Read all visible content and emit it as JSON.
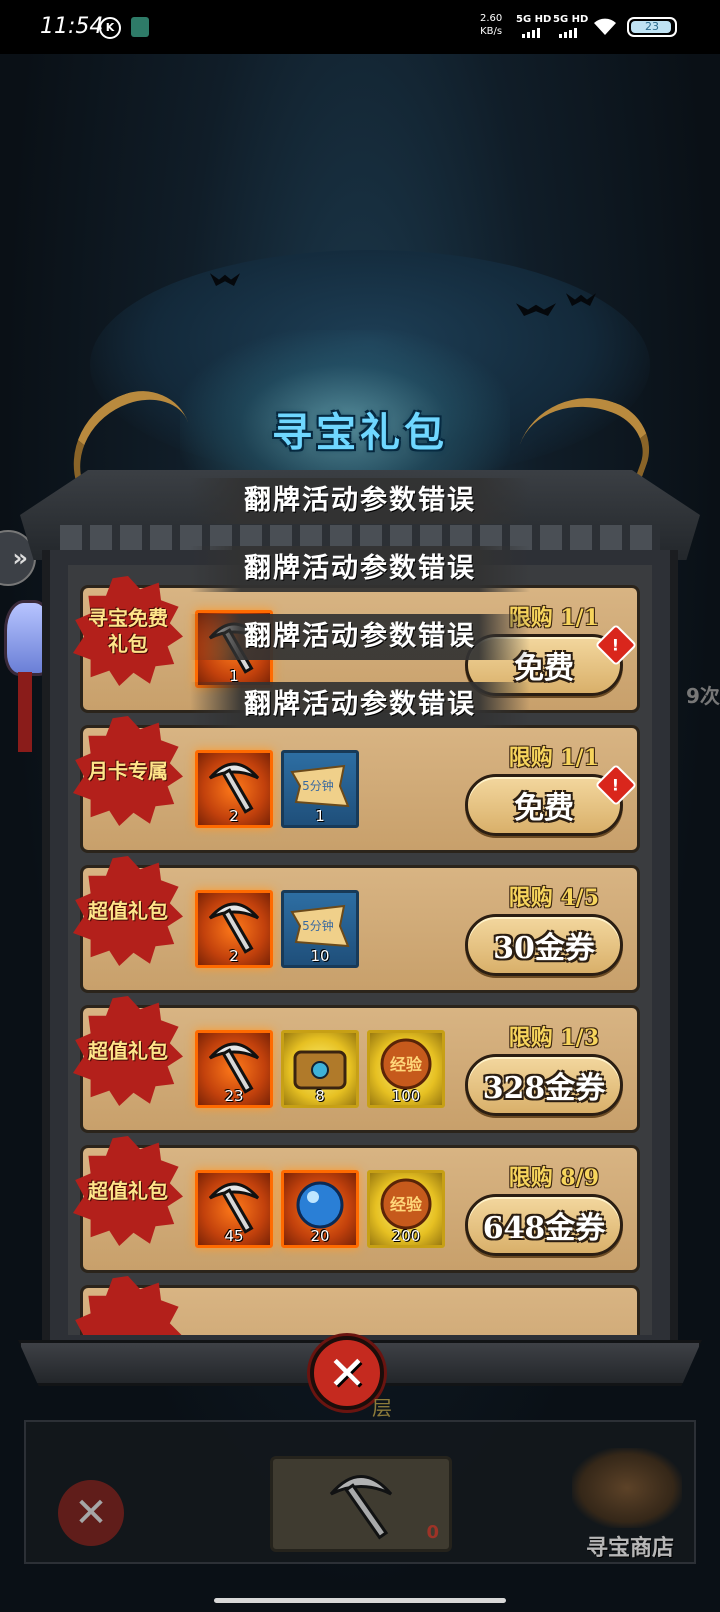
{
  "status_bar": {
    "time": "11:54",
    "k_icon": "K",
    "speed_value": "2.60",
    "speed_unit": "KB/s",
    "net1": "5G HD",
    "net2": "5G HD",
    "battery": "23"
  },
  "panel": {
    "title": "寻宝礼包",
    "close_icon": "close-icon"
  },
  "error_toasts": [
    "翻牌活动参数错误",
    "翻牌活动参数错误",
    "翻牌活动参数错误",
    "翻牌活动参数错误"
  ],
  "packs": [
    {
      "badge": "寻宝免费礼包",
      "limit": "限购 1/1",
      "price": "免费",
      "alert": true,
      "items": [
        {
          "icon": "pickaxe-icon",
          "count": "1",
          "style": "orange"
        }
      ]
    },
    {
      "badge": "月卡专属",
      "limit": "限购 1/1",
      "price": "免费",
      "alert": true,
      "items": [
        {
          "icon": "pickaxe-icon",
          "count": "2",
          "style": "orange"
        },
        {
          "icon": "ticket-icon",
          "count": "1",
          "style": "blue"
        }
      ]
    },
    {
      "badge": "超值礼包",
      "limit": "限购 4/5",
      "price": "30金券",
      "alert": false,
      "items": [
        {
          "icon": "pickaxe-icon",
          "count": "2",
          "style": "orange"
        },
        {
          "icon": "ticket-icon",
          "count": "10",
          "style": "blue"
        }
      ]
    },
    {
      "badge": "超值礼包",
      "limit": "限购 1/3",
      "price": "328金券",
      "alert": false,
      "items": [
        {
          "icon": "pickaxe-icon",
          "count": "23",
          "style": "orange"
        },
        {
          "icon": "treasure-chest-icon",
          "count": "8",
          "style": "gold"
        },
        {
          "icon": "exp-orb-icon",
          "count": "100",
          "style": "gold"
        }
      ]
    },
    {
      "badge": "超值礼包",
      "limit": "限购 8/9",
      "price": "648金券",
      "alert": false,
      "items": [
        {
          "icon": "pickaxe-icon",
          "count": "45",
          "style": "orange"
        },
        {
          "icon": "blue-orb-icon",
          "count": "20",
          "style": "orange"
        },
        {
          "icon": "exp-orb-icon",
          "count": "200",
          "style": "gold"
        }
      ]
    }
  ],
  "ticket_text": "5分钟",
  "orb_text": "经验",
  "alert_mark": "!",
  "side_times": "9次",
  "floor_label": "层",
  "footer": {
    "slot_count": "0",
    "shop_label": "寻宝商店"
  }
}
